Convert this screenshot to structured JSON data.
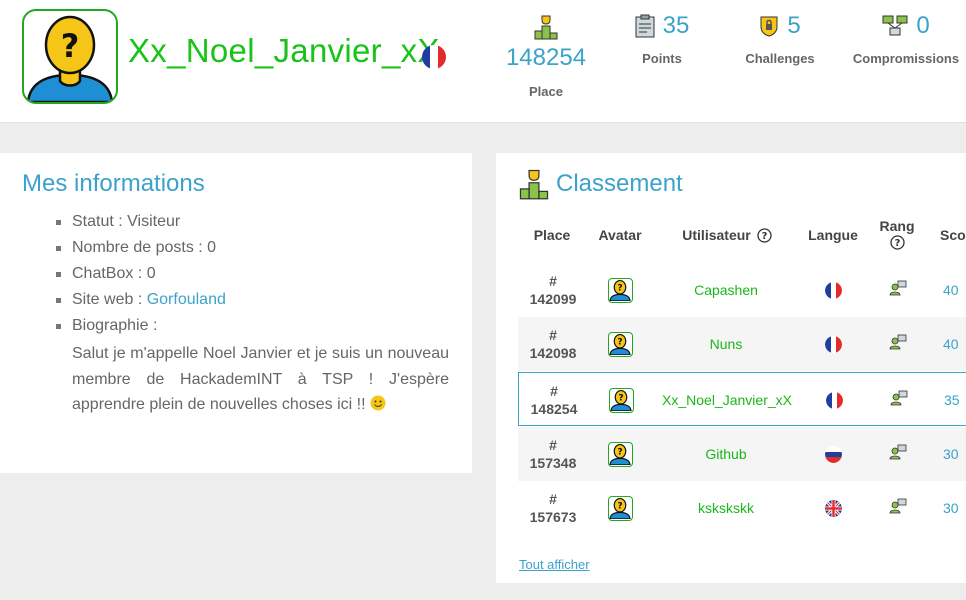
{
  "profile": {
    "username": "Xx_Noel_Janvier_xX",
    "flag_icon": "france-flag-icon",
    "accent_color": "#17c417"
  },
  "stats": {
    "place": {
      "value": "148254",
      "label": "Place"
    },
    "points": {
      "value": "35",
      "label": "Points"
    },
    "challenges": {
      "value": "5",
      "label": "Challenges"
    },
    "compromissions": {
      "value": "0",
      "label": "Compromissions"
    }
  },
  "info": {
    "title": "Mes informations",
    "statut": "Statut : Visiteur",
    "posts": "Nombre de posts : 0",
    "chatbox": "ChatBox : 0",
    "website_label": "Site web : ",
    "website_link": "Gorfouland",
    "bio_label": "Biographie :",
    "bio_text": "Salut je m'appelle Noel Janvier et je suis un nouveau membre de HackademINT à TSP ! J'espère apprendre plein de nouvelles choses ici !! "
  },
  "classement": {
    "title": "Classement",
    "headers": {
      "place": "Place",
      "avatar": "Avatar",
      "user": "Utilisateur",
      "lang": "Langue",
      "rang": "Rang",
      "score": "Sco"
    },
    "rows": [
      {
        "hash": "#",
        "place": "142099",
        "user": "Capashen",
        "lang": "fr",
        "score": "40"
      },
      {
        "hash": "#",
        "place": "142098",
        "user": "Nuns",
        "lang": "fr",
        "score": "40"
      },
      {
        "hash": "#",
        "place": "148254",
        "user": "Xx_Noel_Janvier_xX",
        "lang": "fr",
        "score": "35"
      },
      {
        "hash": "#",
        "place": "157348",
        "user": "Github",
        "lang": "ru",
        "score": "30"
      },
      {
        "hash": "#",
        "place": "157673",
        "user": "kskskskk",
        "lang": "gb",
        "score": "30"
      }
    ],
    "see_all": "Tout afficher"
  },
  "colors": {
    "link": "#3ba2c9",
    "user_green": "#1ab71a"
  }
}
